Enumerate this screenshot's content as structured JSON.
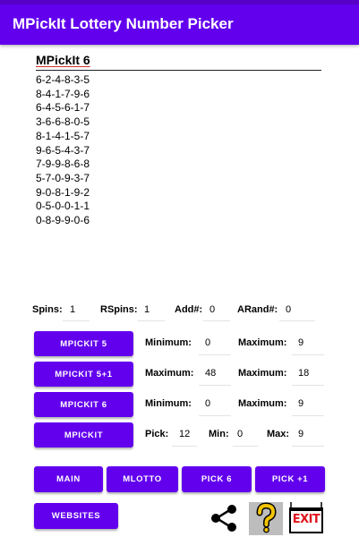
{
  "app_bar": {
    "title": "MPickIt Lottery Number Picker"
  },
  "picker": {
    "title": "MPickIt 6",
    "numbers": [
      "6-2-4-8-3-5",
      "8-4-1-7-9-6",
      "6-4-5-6-1-7",
      "3-6-6-8-0-5",
      "8-1-4-1-5-7",
      "9-6-5-4-3-7",
      "7-9-9-8-6-8",
      "5-7-0-9-3-7",
      "9-0-8-1-9-2",
      "0-5-0-0-1-1",
      "0-8-9-9-0-6"
    ]
  },
  "stats": {
    "spins_label": "Spins:",
    "spins_value": "1",
    "rspins_label": "RSpins:",
    "rspins_value": "1",
    "add_label": "Add#:",
    "add_value": "0",
    "arand_label": "ARand#:",
    "arand_value": "0"
  },
  "rows": {
    "mpickit5": {
      "button": "MPICKIT 5",
      "min_label": "Minimum:",
      "min_value": "0",
      "max_label": "Maximum:",
      "max_value": "9"
    },
    "mpickit5p1": {
      "button": "MPICKIT 5+1",
      "max1_label": "Maximum:",
      "max1_value": "48",
      "max2_label": "Maximum:",
      "max2_value": "18"
    },
    "mpickit6": {
      "button": "MPICKIT 6",
      "min_label": "Minimum:",
      "min_value": "0",
      "max_label": "Maximum:",
      "max_value": "9"
    },
    "mpickit": {
      "button": "MPICKIT",
      "pick_label": "Pick:",
      "pick_value": "12",
      "min_label": "Min:",
      "min_value": "0",
      "max_label": "Max:",
      "max_value": "9"
    }
  },
  "nav": {
    "main": "MAIN",
    "mlotto": "MLOTTO",
    "pick6": "PICK 6",
    "pick_plus1": "PICK +1",
    "websites": "WEBSITES"
  },
  "icons": {
    "share": "share-icon",
    "help": "help-icon",
    "exit": "exit-sign-icon",
    "exit_text": "EXIT"
  },
  "colors": {
    "primary": "#6200ee",
    "status_bar": "#5600c8",
    "help_bg": "#bdbdbd",
    "help_question": "#f2c400",
    "exit_red": "#e0141c"
  }
}
